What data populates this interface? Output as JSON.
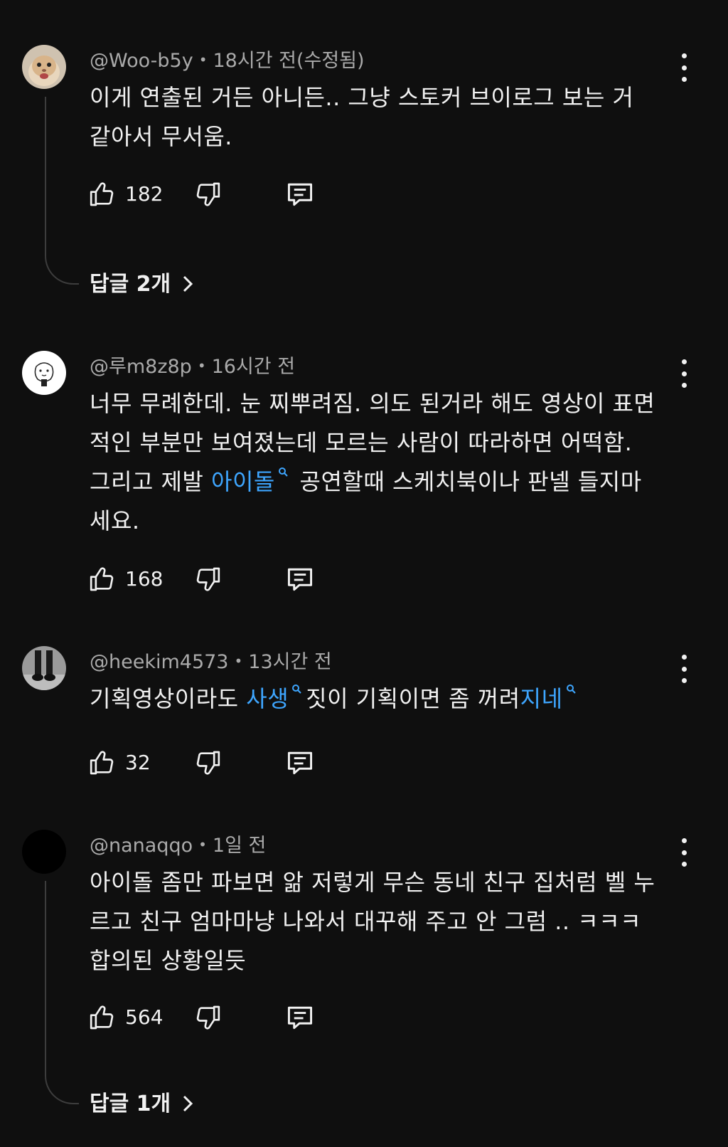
{
  "comments": [
    {
      "author": "@Woo-b5y",
      "time": "18시간 전(수정됨)",
      "lines": [
        "이게 연출된 거든 아니든.. 그냥 스토커 브이로그 보는 거",
        "같아서 무서움."
      ],
      "likes": "182",
      "replies_label": "답글 2개",
      "avatar": "hamster-avatar"
    },
    {
      "author": "@루m8z8p",
      "time": "16시간 전",
      "lines": [
        "너무 무례한데. 눈 찌뿌려짐. 의도 된거라 해도 영상이 표면",
        "적인 부분만 보여졌는데 모르는 사람이 따라하면 어떡함.",
        "",
        "세요."
      ],
      "line3_before": "그리고 제발 ",
      "line3_link": "아이돌",
      "line3_after": " 공연할때 스케치북이나 판넬 들지마",
      "likes": "168",
      "avatar": "cartoon-avatar"
    },
    {
      "author": "@heekim4573",
      "time": "13시간 전",
      "text_part1": "기획영상이라도 ",
      "link1": "사생",
      "text_part2": "짓이 기획이면 좀 꺼려",
      "link2": "지네",
      "likes": "32",
      "avatar": "boots-avatar"
    },
    {
      "author": "@nanaqqo",
      "time": "1일 전",
      "lines": [
        "아이돌 좀만 파보면 앎 저렇게 무슨 동네 친구 집처럼 벨 누",
        "르고 친구 엄마마냥 나와서 대꾸해 주고 안 그럼 .. ㅋㅋㅋ",
        "합의된 상황일듯"
      ],
      "likes": "564",
      "replies_label": "답글 1개",
      "avatar": "black-avatar"
    }
  ],
  "colors": {
    "background": "#0f0f0f",
    "text": "#f1f1f1",
    "meta": "#aaaaaa",
    "link": "#3ea6ff",
    "thread_line": "#3d3d3d"
  },
  "icons": {
    "like": "thumbs-up-icon",
    "dislike": "thumbs-down-icon",
    "reply": "comment-icon",
    "more": "more-vert-icon",
    "expand": "chevron-right-icon",
    "hashtag_search": "search-icon"
  }
}
